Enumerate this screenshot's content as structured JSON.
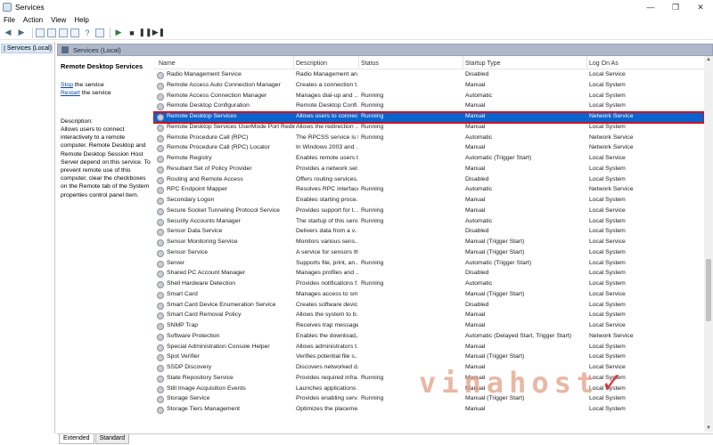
{
  "window": {
    "title": "Services",
    "minimize": "—",
    "maximize": "❐",
    "close": "✕"
  },
  "menu": [
    "File",
    "Action",
    "View",
    "Help"
  ],
  "tree": {
    "root_label": "Services (Local)"
  },
  "header": {
    "title": "Services (Local)"
  },
  "description_pane": {
    "service_name": "Remote Desktop Services",
    "stop_link": "Stop",
    "stop_suffix": " the service",
    "restart_link": "Restart",
    "restart_suffix": " the service",
    "description_label": "Description:",
    "description_text": "Allows users to connect interactively to a remote computer. Remote Desktop and Remote Desktop Session Host Server depend on this service. To prevent remote use of this computer, clear the checkboxes on the Remote tab of the System properties control panel item."
  },
  "columns": {
    "name": "Name",
    "description": "Description",
    "status": "Status",
    "startup": "Startup Type",
    "logon": "Log On As"
  },
  "services": [
    [
      "Radio Management Service",
      "Radio Management an...",
      "",
      "Disabled",
      "Local Service"
    ],
    [
      "Remote Access Auto Connection Manager",
      "Creates a connection t...",
      "",
      "Manual",
      "Local System"
    ],
    [
      "Remote Access Connection Manager",
      "Manages dial-up and ...",
      "Running",
      "Automatic",
      "Local System"
    ],
    [
      "Remote Desktop Configuration",
      "Remote Desktop Confi...",
      "Running",
      "Manual",
      "Local System"
    ],
    [
      "Remote Desktop Services",
      "Allows users to connec...",
      "Running",
      "Manual",
      "Network Service"
    ],
    [
      "Remote Desktop Services UserMode Port Redirector",
      "Allows the redirection ...",
      "Running",
      "Manual",
      "Local System"
    ],
    [
      "Remote Procedure Call (RPC)",
      "The RPCSS service is th...",
      "Running",
      "Automatic",
      "Network Service"
    ],
    [
      "Remote Procedure Call (RPC) Locator",
      "In Windows 2003 and ...",
      "",
      "Manual",
      "Network Service"
    ],
    [
      "Remote Registry",
      "Enables remote users t...",
      "",
      "Automatic (Trigger Start)",
      "Local Service"
    ],
    [
      "Resultant Set of Policy Provider",
      "Provides a network ser...",
      "",
      "Manual",
      "Local System"
    ],
    [
      "Routing and Remote Access",
      "Offers routing services...",
      "",
      "Disabled",
      "Local System"
    ],
    [
      "RPC Endpoint Mapper",
      "Resolves RPC interface...",
      "Running",
      "Automatic",
      "Network Service"
    ],
    [
      "Secondary Logon",
      "Enables starting proce...",
      "",
      "Manual",
      "Local System"
    ],
    [
      "Secure Socket Tunneling Protocol Service",
      "Provides support for t...",
      "Running",
      "Manual",
      "Local Service"
    ],
    [
      "Security Accounts Manager",
      "The startup of this serv...",
      "Running",
      "Automatic",
      "Local System"
    ],
    [
      "Sensor Data Service",
      "Delivers data from a v...",
      "",
      "Disabled",
      "Local System"
    ],
    [
      "Sensor Monitoring Service",
      "Monitors various sens...",
      "",
      "Manual (Trigger Start)",
      "Local Service"
    ],
    [
      "Sensor Service",
      "A service for sensors th...",
      "",
      "Manual (Trigger Start)",
      "Local System"
    ],
    [
      "Server",
      "Supports file, print, an...",
      "Running",
      "Automatic (Trigger Start)",
      "Local System"
    ],
    [
      "Shared PC Account Manager",
      "Manages profiles and ...",
      "",
      "Disabled",
      "Local System"
    ],
    [
      "Shell Hardware Detection",
      "Provides notifications f...",
      "Running",
      "Automatic",
      "Local System"
    ],
    [
      "Smart Card",
      "Manages access to sm...",
      "",
      "Manual (Trigger Start)",
      "Local Service"
    ],
    [
      "Smart Card Device Enumeration Service",
      "Creates software devic...",
      "",
      "Disabled",
      "Local System"
    ],
    [
      "Smart Card Removal Policy",
      "Allows the system to b...",
      "",
      "Manual",
      "Local System"
    ],
    [
      "SNMP Trap",
      "Receives trap message...",
      "",
      "Manual",
      "Local Service"
    ],
    [
      "Software Protection",
      "Enables the download,...",
      "",
      "Automatic (Delayed Start, Trigger Start)",
      "Network Service"
    ],
    [
      "Special Administration Console Helper",
      "Allows administrators t...",
      "",
      "Manual",
      "Local System"
    ],
    [
      "Spot Verifier",
      "Verifies potential file s...",
      "",
      "Manual (Trigger Start)",
      "Local System"
    ],
    [
      "SSDP Discovery",
      "Discovers networked d...",
      "",
      "Manual",
      "Local Service"
    ],
    [
      "State Repository Service",
      "Provides required infra...",
      "Running",
      "Manual",
      "Local System"
    ],
    [
      "Still Image Acquisition Events",
      "Launches applications ...",
      "",
      "Manual",
      "Local System"
    ],
    [
      "Storage Service",
      "Provides enabling serv...",
      "Running",
      "Manual (Trigger Start)",
      "Local System"
    ],
    [
      "Storage Tiers Management",
      "Optimizes the placeme...",
      "",
      "Manual",
      "Local System"
    ]
  ],
  "selected_index": 4,
  "tabs": [
    "Extended",
    "Standard"
  ],
  "watermark": {
    "text": "vinahost",
    "mark": "✓"
  }
}
